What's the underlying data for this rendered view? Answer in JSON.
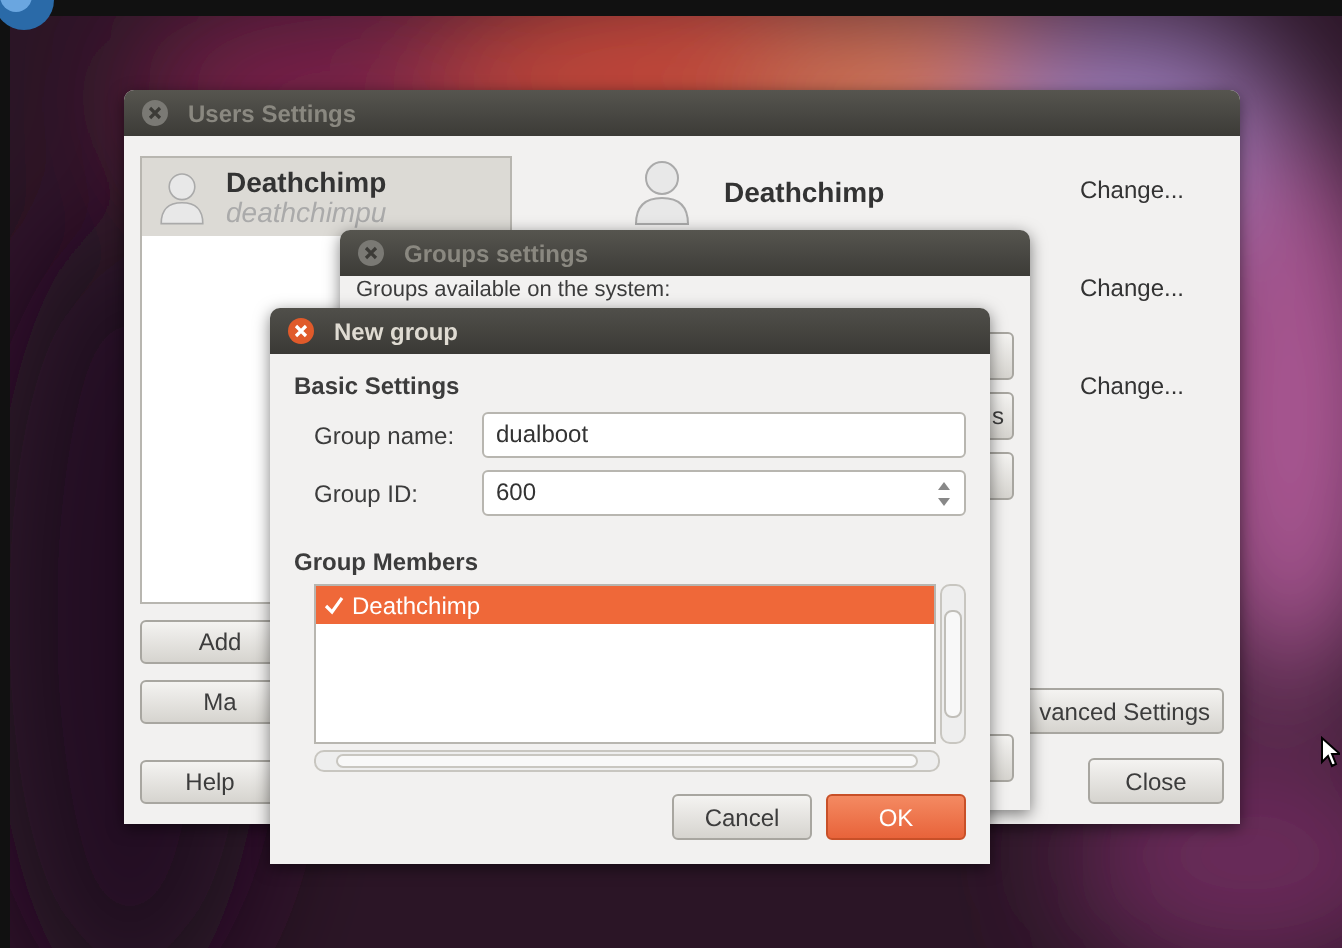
{
  "users_window": {
    "title": "Users Settings",
    "users": [
      {
        "name": "Deathchimp",
        "login": "deathchimpu",
        "selected": true
      }
    ],
    "detail_name": "Deathchimp",
    "change_links": [
      "Change...",
      "Change...",
      "Change..."
    ],
    "list_buttons": [
      "Add",
      "Ma"
    ],
    "help_button": "Help",
    "advanced_button": "vanced Settings",
    "close_button": "Close"
  },
  "groups_window": {
    "title": "Groups settings",
    "caption": "Groups available on the system:",
    "side_buttons": [
      {
        "kind": "blank"
      },
      {
        "kind": "label",
        "label": "s"
      },
      {
        "kind": "blank"
      }
    ]
  },
  "new_group_dialog": {
    "title": "New group",
    "basic_heading": "Basic Settings",
    "fields": [
      {
        "kind": "text",
        "label": "Group name:",
        "value": "dualboot"
      },
      {
        "kind": "spin",
        "label": "Group ID:",
        "value": "600"
      }
    ],
    "members_heading": "Group Members",
    "members": [
      {
        "name": "Deathchimp",
        "checked": true,
        "selected": true
      }
    ],
    "buttons": [
      {
        "kind": "normal",
        "label": "Cancel"
      },
      {
        "kind": "primary",
        "label": "OK"
      }
    ]
  }
}
